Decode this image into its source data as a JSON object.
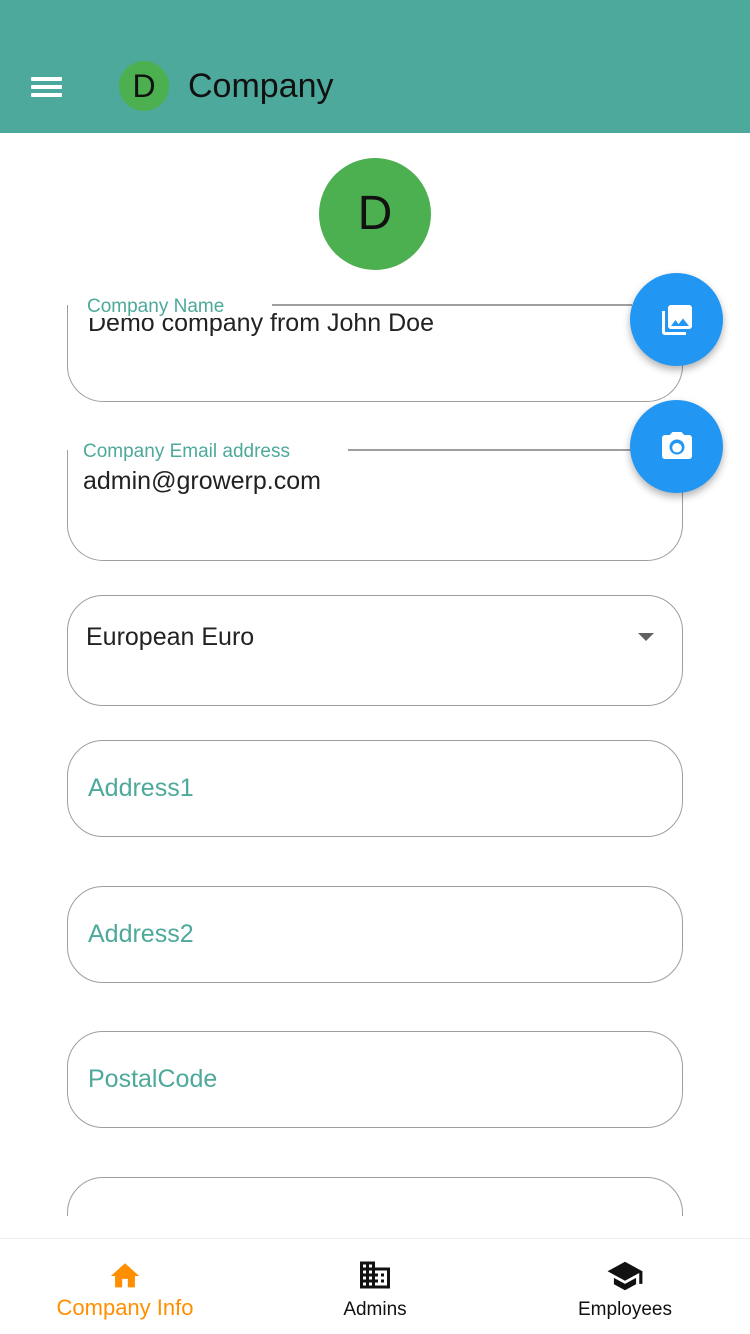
{
  "appbar": {
    "avatar_letter": "D",
    "title": "Company"
  },
  "company_avatar": {
    "letter": "D"
  },
  "form": {
    "company_name": {
      "label": "Company Name",
      "value": "Demo company from John Doe"
    },
    "company_email": {
      "label": "Company Email address",
      "value": "admin@growerp.com"
    },
    "currency": {
      "selected": "European Euro"
    },
    "address1": {
      "placeholder": "Address1"
    },
    "address2": {
      "placeholder": "Address2"
    },
    "postal_code": {
      "placeholder": "PostalCode"
    }
  },
  "fabs": {
    "gallery_icon": "photo-library-icon",
    "camera_icon": "camera-icon"
  },
  "bottom_nav": {
    "items": [
      {
        "label": "Company Info",
        "icon": "home-icon",
        "active": true
      },
      {
        "label": "Admins",
        "icon": "building-icon",
        "active": false
      },
      {
        "label": "Employees",
        "icon": "graduation-cap-icon",
        "active": false
      }
    ]
  },
  "colors": {
    "appbar": "#4da99b",
    "accent": "#4da99b",
    "avatar": "#4caf50",
    "fab": "#2196f3",
    "active_nav": "#ff8f00"
  }
}
